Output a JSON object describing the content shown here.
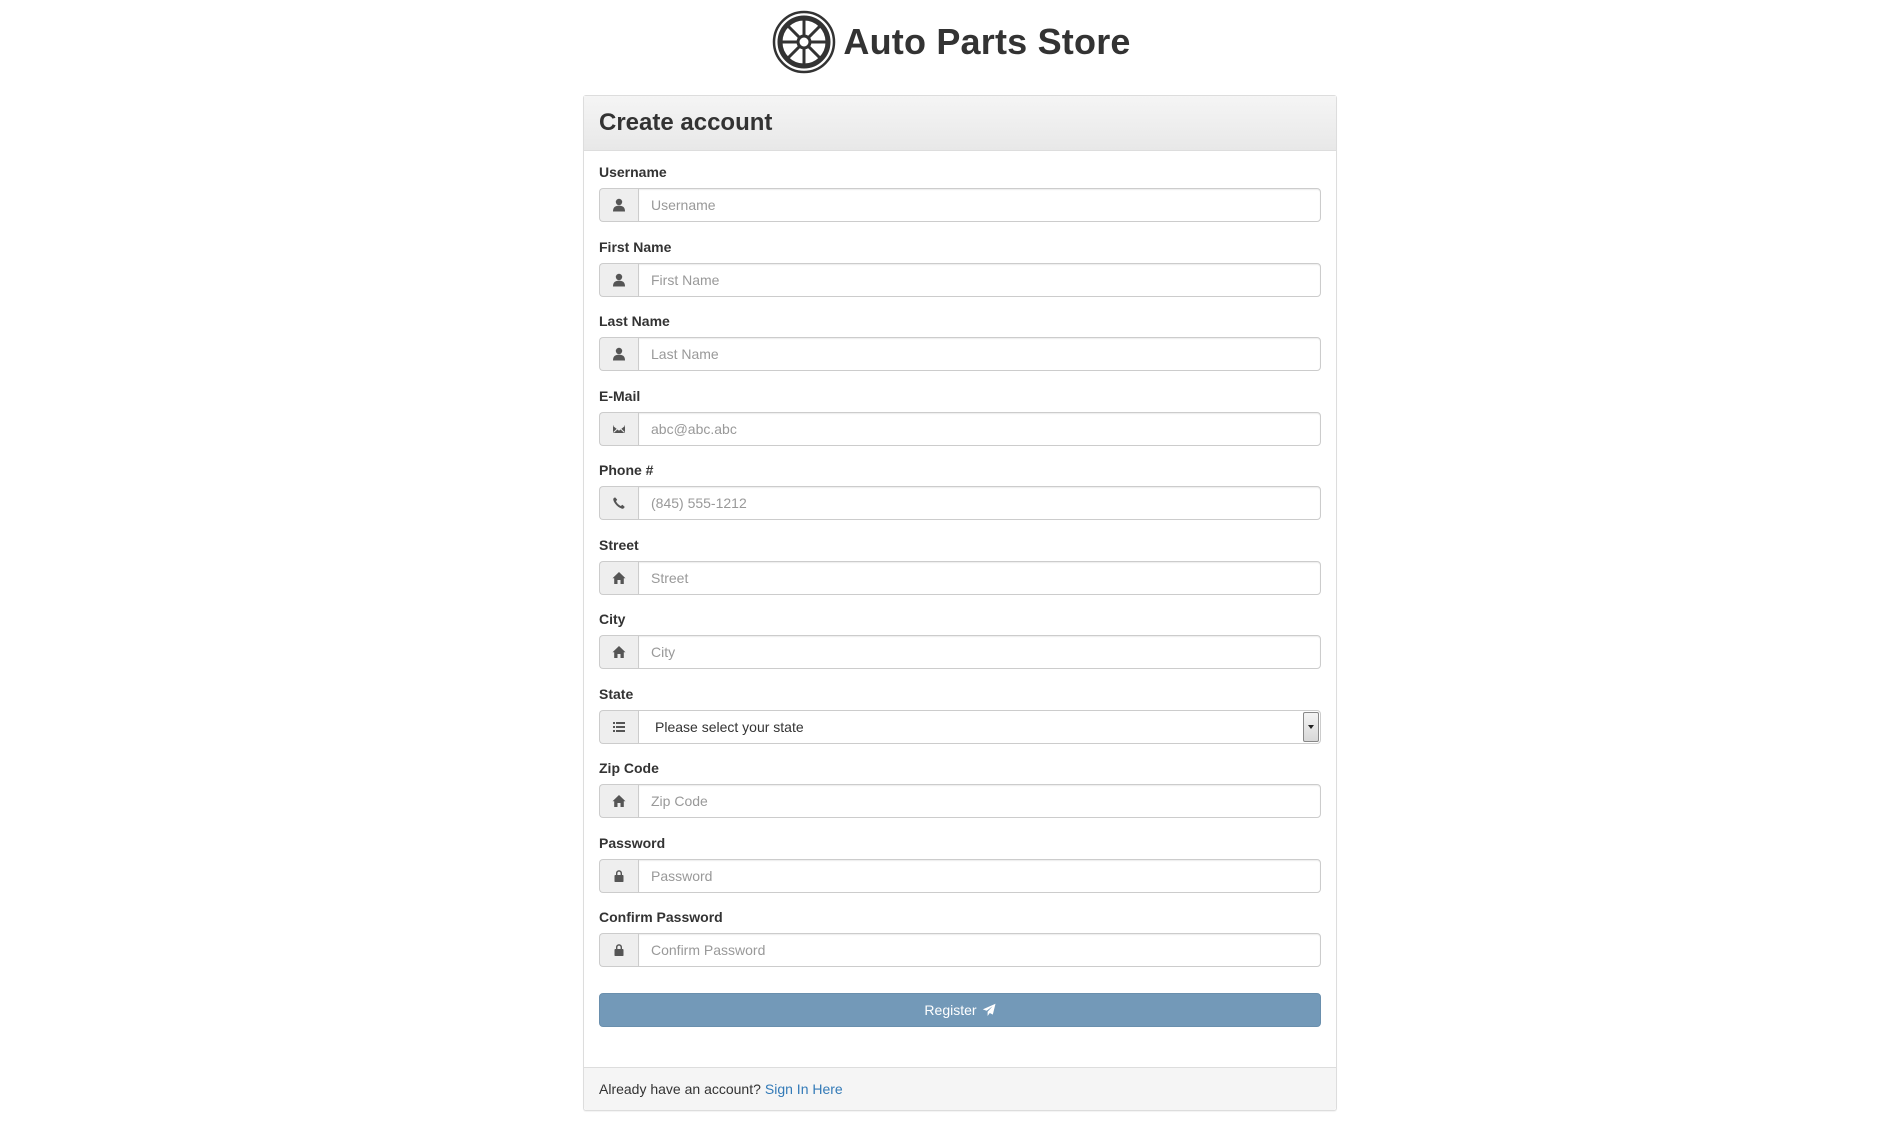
{
  "brand": {
    "name": "Auto Parts Store",
    "logo_icon": "wheel-icon"
  },
  "panel": {
    "title": "Create account"
  },
  "fields": [
    {
      "label": "Username",
      "placeholder": "Username",
      "icon": "user-icon"
    },
    {
      "label": "First Name",
      "placeholder": "First Name",
      "icon": "user-icon"
    },
    {
      "label": "Last Name",
      "placeholder": "Last Name",
      "icon": "user-icon"
    },
    {
      "label": "E-Mail",
      "placeholder": "abc@abc.abc",
      "icon": "envelope-icon"
    },
    {
      "label": "Phone #",
      "placeholder": "(845) 555-1212",
      "icon": "phone-icon"
    },
    {
      "label": "Street",
      "placeholder": "Street",
      "icon": "home-icon"
    },
    {
      "label": "City",
      "placeholder": "City",
      "icon": "home-icon"
    },
    {
      "label": "State",
      "selected": "Please select your state",
      "icon": "list-icon"
    },
    {
      "label": "Zip Code",
      "placeholder": "Zip Code",
      "icon": "home-icon"
    },
    {
      "label": "Password",
      "placeholder": "Password",
      "icon": "lock-icon"
    },
    {
      "label": "Confirm Password",
      "placeholder": "Confirm Password",
      "icon": "lock-icon"
    }
  ],
  "register": {
    "label": "Register",
    "icon": "send-icon"
  },
  "footer": {
    "text": "Already have an account?",
    "link": "Sign In Here"
  },
  "colors": {
    "button": "#7399b8",
    "link": "#337ab7",
    "heading_bg": "#f0f0f0"
  }
}
